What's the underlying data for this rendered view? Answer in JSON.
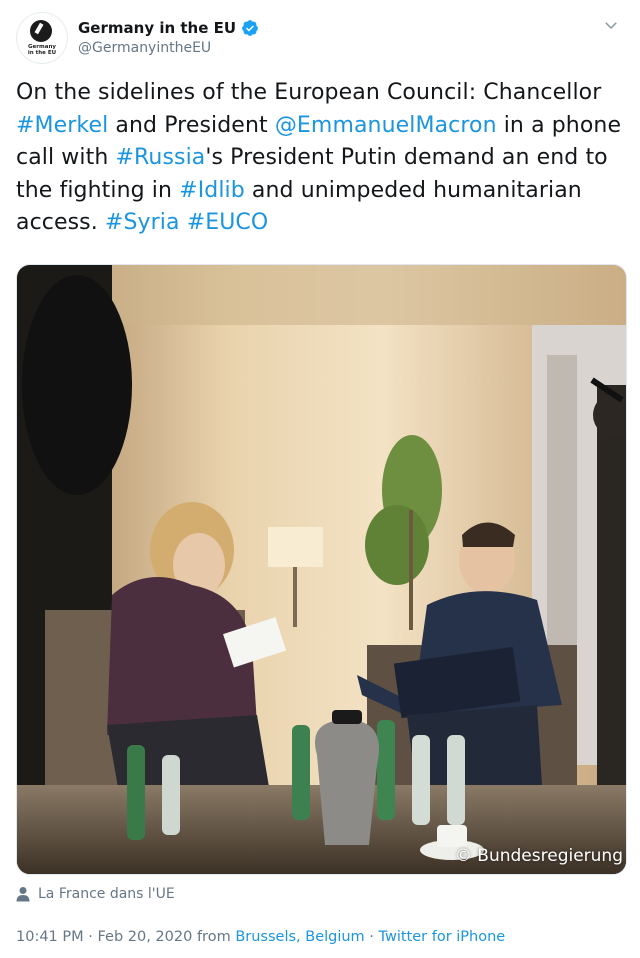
{
  "account": {
    "display_name": "Germany in the EU",
    "handle": "@GermanyintheEU",
    "avatar_text": "Germany\nin the EU",
    "verified": true
  },
  "tweet": {
    "segments": [
      {
        "text": "On the sidelines of the European Council: Chancellor ",
        "link": false
      },
      {
        "text": "#Merkel",
        "link": true
      },
      {
        "text": " and President ",
        "link": false
      },
      {
        "text": "@EmmanuelMacron",
        "link": true
      },
      {
        "text": " in a phone call with ",
        "link": false
      },
      {
        "text": "#Russia",
        "link": true
      },
      {
        "text": "'s President Putin demand an end to the fighting in ",
        "link": false
      },
      {
        "text": "#Idlib",
        "link": true
      },
      {
        "text": " and unimpeded humanitarian access. ",
        "link": false
      },
      {
        "text": "#Syria",
        "link": true
      },
      {
        "text": " ",
        "link": false
      },
      {
        "text": "#EUCO",
        "link": true
      }
    ]
  },
  "photo": {
    "credit": "© Bundesregierung"
  },
  "tagged_location": "La France dans l'UE",
  "meta": {
    "time": "10:41 PM",
    "separator": " · ",
    "date": "Feb 20, 2020",
    "from_word": " from ",
    "place": "Brussels, Belgium",
    "client": "Twitter for iPhone"
  },
  "colors": {
    "link": "#1b95e0",
    "text": "#14171a",
    "secondary": "#657786"
  },
  "icons": {
    "verified": "verified-badge-icon",
    "caret": "chevron-down-icon",
    "person": "person-icon"
  }
}
